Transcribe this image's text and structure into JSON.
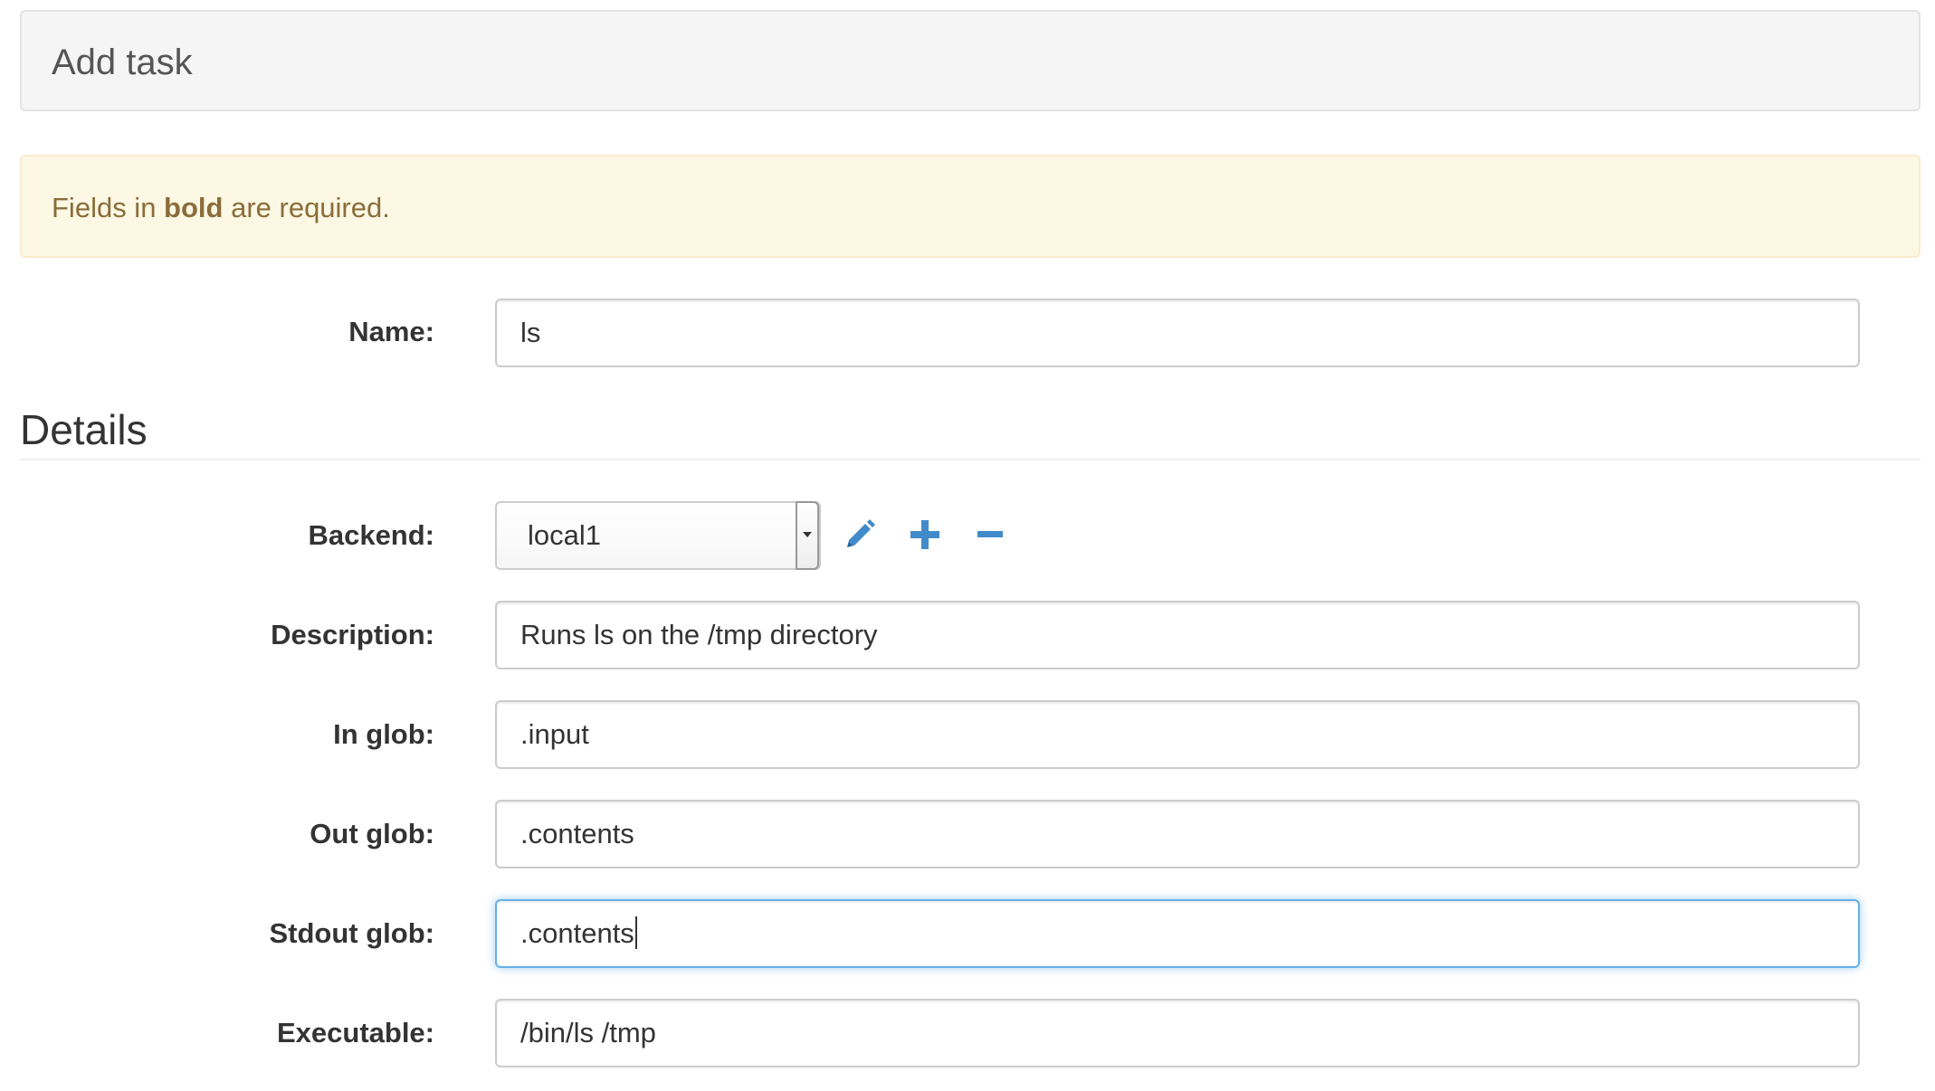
{
  "header": {
    "title": "Add task"
  },
  "alert": {
    "prefix": "Fields in ",
    "bold": "bold",
    "suffix": " are required."
  },
  "form": {
    "name": {
      "label": "Name:",
      "value": "ls"
    },
    "section_title": "Details",
    "backend": {
      "label": "Backend:",
      "selected": "local1",
      "actions": [
        "pencil-icon",
        "plus-icon",
        "minus-icon"
      ]
    },
    "description": {
      "label": "Description:",
      "value": "Runs ls on the /tmp directory"
    },
    "in_glob": {
      "label": "In glob:",
      "value": ".input"
    },
    "out_glob": {
      "label": "Out glob:",
      "value": ".contents"
    },
    "stdout_glob": {
      "label": "Stdout glob:",
      "value": ".contents"
    },
    "executable": {
      "label": "Executable:",
      "value": "/bin/ls /tmp"
    }
  },
  "colors": {
    "accent": "#428bca",
    "focus_border": "#66afe9",
    "alert_text": "#8a6d3b",
    "alert_bg": "#fcf8e3"
  }
}
